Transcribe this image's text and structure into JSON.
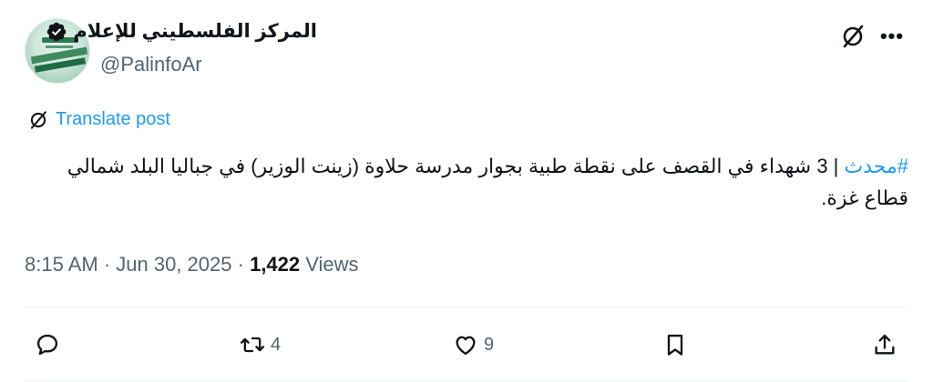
{
  "post": {
    "display_name": "المركز الفلسطيني للإعلام",
    "handle": "@PalinfoAr",
    "translate_label": "Translate post",
    "hashtag": "#محدث",
    "body": " | 3 شهداء في القصف على نقطة طبية بجوار مدرسة حلاوة (زينت الوزير) في جباليا البلد شمالي قطاع غزة.",
    "time": "8:15 AM",
    "date": "Jun 30, 2025",
    "views_count": "1,422",
    "views_label": "Views",
    "sep": " · "
  },
  "actions": {
    "reply_count": "",
    "repost_count": "4",
    "like_count": "9"
  },
  "colors": {
    "accent": "#1d9bf0",
    "muted": "#536471",
    "text": "#0f1419"
  },
  "icons": [
    "grok-icon",
    "more-icon",
    "verified-badge-icon",
    "reply-icon",
    "repost-icon",
    "like-icon",
    "bookmark-icon",
    "share-icon"
  ]
}
